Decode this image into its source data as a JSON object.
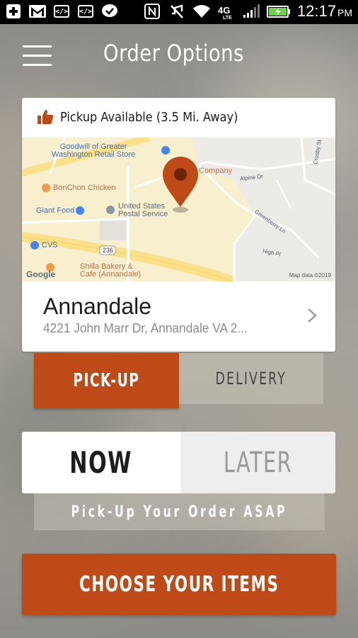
{
  "status_bar": {
    "time": "12:17",
    "ampm": "PM",
    "network": "4G LTE"
  },
  "header": {
    "title": "Order Options"
  },
  "location_card": {
    "availability": "Pickup Available (3.5 Mi. Away)",
    "name": "Annandale",
    "address": "4221 John Marr Dr, Annandale VA 2...",
    "map": {
      "labels": {
        "goodwill": "Goodwill of Greater\nWashington Retail Store",
        "company": "Company",
        "bonchon": "BonChon Chicken",
        "giant": "Giant Food",
        "usps": "United States\nPostal Service",
        "cvs": "CVS",
        "shilla": "Shilla Bakery &\nCafe (Annandale)",
        "alpine": "Alpine Dr",
        "crosby": "Crosby St",
        "greenberry": "Greenberry Ln",
        "high": "High Pl",
        "route": "236",
        "google": "Google",
        "mapdata": "Map data ©2019"
      }
    }
  },
  "order_type": {
    "pickup": "PICK-UP",
    "delivery": "DELIVERY",
    "selected": "PICK-UP"
  },
  "order_time": {
    "now": "NOW",
    "later": "LATER",
    "selected": "NOW",
    "note": "Pick-Up Your Order ASAP"
  },
  "cta": {
    "label": "CHOOSE YOUR ITEMS"
  },
  "colors": {
    "accent": "#bd4a17",
    "white": "#ffffff"
  }
}
